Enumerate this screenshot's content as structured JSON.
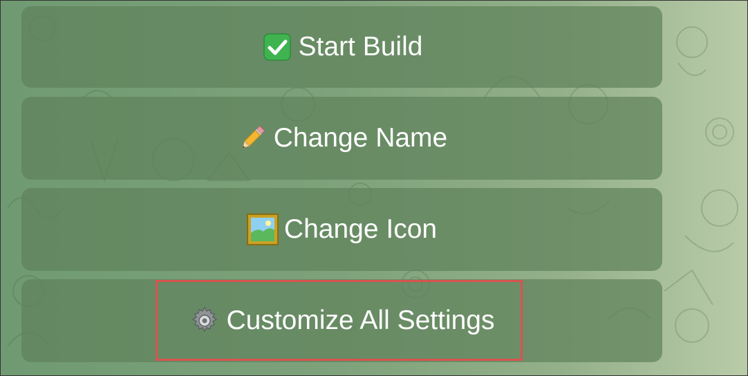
{
  "buttons": [
    {
      "label": "Start Build",
      "icon": "check-mark-icon"
    },
    {
      "label": "Change Name",
      "icon": "pencil-icon"
    },
    {
      "label": "Change Icon",
      "icon": "framed-picture-icon"
    },
    {
      "label": "Customize All Settings",
      "icon": "gear-icon"
    }
  ],
  "colors": {
    "background_left": "#6f9a72",
    "background_right": "#b9cba8",
    "button_fill": "#5f825c",
    "button_text": "#ffffff",
    "highlight_border": "#d9534f",
    "check_green": "#3fb34f"
  }
}
